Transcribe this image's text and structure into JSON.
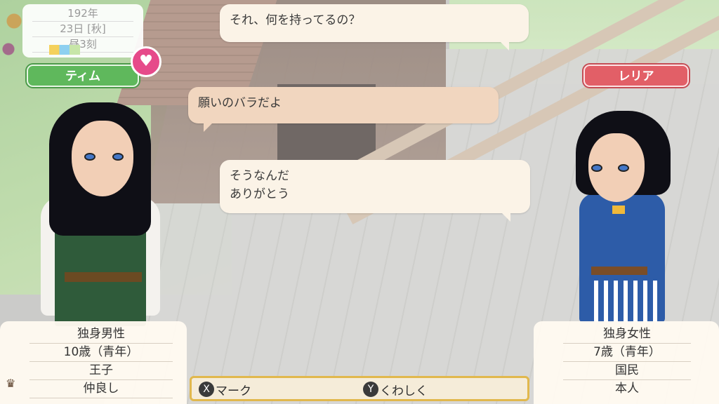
{
  "date": {
    "year": "192年",
    "day": "23日 [秋]",
    "time": "昼3刻"
  },
  "characters": {
    "left": {
      "name": "ティム",
      "info": [
        "独身男性",
        "10歳（青年）",
        "王子",
        "仲良し"
      ]
    },
    "right": {
      "name": "レリア",
      "info": [
        "独身女性",
        "7歳（青年）",
        "国民",
        "本人"
      ]
    }
  },
  "dialogue": [
    {
      "text": "それ、何を持ってるの？"
    },
    {
      "text": "願いのバラだよ"
    },
    {
      "line1": "そうなんだ",
      "line2": "ありがとう"
    }
  ],
  "buttons": {
    "mark": {
      "glyph": "X",
      "label": "マーク"
    },
    "detail": {
      "glyph": "Y",
      "label": "くわしく"
    }
  },
  "icons": {
    "heart": "heart-icon",
    "crown": "crown-icon"
  },
  "colors": {
    "left_tag": "#5fb85c",
    "right_tag": "#e25f67",
    "heart": "#e64a8a",
    "button_border": "#e1b84d"
  }
}
